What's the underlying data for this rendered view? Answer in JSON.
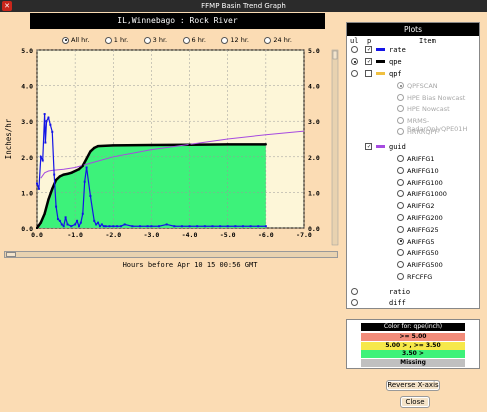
{
  "window": {
    "title": "FFMP Basin Trend Graph"
  },
  "location": "IL,Winnebago : Rock River",
  "time_options": [
    {
      "label": "All hr.",
      "selected": true
    },
    {
      "label": "1 hr.",
      "selected": false
    },
    {
      "label": "3 hr.",
      "selected": false
    },
    {
      "label": "6 hr.",
      "selected": false
    },
    {
      "label": "12 hr.",
      "selected": false
    },
    {
      "label": "24 hr.",
      "selected": false
    }
  ],
  "graph": {
    "ylabel": "Inches/hr",
    "xtitle": "Hours before Apr 10 15 00:56 GMT"
  },
  "chart_data": {
    "type": "line",
    "xlabel": "Hours before Apr 10 15 00:56 GMT",
    "ylabel": "Inches/hr",
    "xlim": [
      0.0,
      -7.0
    ],
    "ylim": [
      0.0,
      5.0
    ],
    "x_ticks": [
      "0.0",
      "-1.0",
      "-2.0",
      "-3.0",
      "-4.0",
      "-5.0",
      "-6.0",
      "-7.0"
    ],
    "y_ticks_left": [
      "0.0",
      "1.0",
      "2.0",
      "3.0",
      "4.0",
      "5.0"
    ],
    "y_ticks_right": [
      "0.0",
      "1.0",
      "2.0",
      "3.0",
      "4.0",
      "5.0"
    ],
    "series": [
      {
        "name": "rate",
        "color": "#1414e6",
        "x": [
          0.0,
          -0.05,
          -0.1,
          -0.15,
          -0.2,
          -0.22,
          -0.25,
          -0.3,
          -0.35,
          -0.4,
          -0.45,
          -0.5,
          -0.55,
          -0.6,
          -0.65,
          -0.7,
          -0.75,
          -0.8,
          -0.9,
          -1.0,
          -1.05,
          -1.1,
          -1.15,
          -1.2,
          -1.25,
          -1.3,
          -1.4,
          -1.5,
          -1.55,
          -1.6,
          -1.65,
          -1.7,
          -1.75,
          -1.8,
          -1.9,
          -2.0,
          -2.1,
          -2.2,
          -2.3,
          -2.5,
          -2.7,
          -2.9,
          -3.0,
          -3.2,
          -3.4,
          -3.6,
          -3.8,
          -4.0,
          -4.2,
          -4.4,
          -4.6,
          -4.8,
          -5.0,
          -5.2,
          -5.4,
          -5.6,
          -5.8,
          -6.0
        ],
        "y": [
          1.25,
          1.1,
          2.0,
          1.9,
          3.2,
          2.4,
          3.0,
          3.1,
          2.9,
          2.7,
          1.5,
          0.6,
          0.25,
          0.2,
          0.1,
          0.05,
          0.3,
          0.1,
          0.05,
          0.1,
          0.2,
          0.05,
          0.15,
          0.4,
          1.3,
          1.7,
          0.9,
          0.2,
          0.1,
          0.15,
          0.05,
          0.1,
          0.05,
          0.05,
          0.05,
          0.05,
          0.05,
          0.05,
          0.1,
          0.05,
          0.05,
          0.05,
          0.05,
          0.05,
          0.1,
          0.05,
          0.05,
          0.05,
          0.05,
          0.05,
          0.05,
          0.05,
          0.05,
          0.05,
          0.05,
          0.05,
          0.05,
          0.05
        ]
      },
      {
        "name": "qpe",
        "color": "#000000",
        "x": [
          0.0,
          -0.1,
          -0.2,
          -0.3,
          -0.4,
          -0.5,
          -0.6,
          -0.7,
          -0.8,
          -0.9,
          -1.0,
          -1.1,
          -1.2,
          -1.3,
          -1.4,
          -1.5,
          -1.6,
          -2.0,
          -3.0,
          -4.0,
          -5.0,
          -6.0
        ],
        "y": [
          0.0,
          0.15,
          0.4,
          0.8,
          1.1,
          1.35,
          1.45,
          1.5,
          1.52,
          1.55,
          1.6,
          1.65,
          1.75,
          1.95,
          2.15,
          2.25,
          2.3,
          2.32,
          2.33,
          2.34,
          2.35,
          2.35
        ]
      },
      {
        "name": "guid",
        "color": "#a64be0",
        "x": [
          -0.1,
          -0.2,
          -0.3,
          -0.4,
          -0.5,
          -0.7,
          -1.0,
          -1.5,
          -2.0,
          -3.0,
          -4.0,
          -5.0,
          -6.0,
          -7.0
        ],
        "y": [
          1.4,
          1.55,
          1.6,
          1.62,
          1.63,
          1.65,
          1.7,
          1.85,
          2.0,
          2.2,
          2.35,
          2.5,
          2.62,
          2.72
        ]
      }
    ],
    "fill_thresholds": {
      "green": "qpe < 3.50",
      "fill_color": "#3df27a"
    },
    "grid": true
  },
  "plots_panel": {
    "title": "Plots",
    "header": {
      "ul": "ul",
      "p": "p",
      "item": "Item"
    },
    "items": [
      {
        "label": "rate",
        "ul": false,
        "p": true,
        "color": "#1414e6"
      },
      {
        "label": "qpe",
        "ul": true,
        "p": true,
        "color": "#000000"
      },
      {
        "label": "qpf",
        "ul": false,
        "p": false,
        "color": "#f0c040"
      }
    ],
    "qpf_sources": [
      "QPFSCAN",
      "HPE Bias Nowcast",
      "HPE Nowcast",
      "MRMS-RadarOnlyQPE01H",
      "HRRRQPF"
    ],
    "qpf_selected": "QPFSCAN",
    "guid": {
      "label": "guid",
      "p": true,
      "color": "#a64be0"
    },
    "guid_sources": [
      "ARIFFG1",
      "ARIFFG10",
      "ARIFFG100",
      "ARIFFG1000",
      "ARIFFG2",
      "ARIFFG200",
      "ARIFFG25",
      "ARIFFG5",
      "ARIFFG50",
      "ARIFFG500",
      "RFCFFG"
    ],
    "guid_selected": "ARIFFG5",
    "ratio": "ratio",
    "diff": "diff"
  },
  "legend": {
    "title": "Color for: qpe(inch)",
    "rows": [
      {
        "label": ">= 5.00",
        "color": "#f28c7a"
      },
      {
        "label": "5.00 > , >= 3.50",
        "color": "#f6e84a"
      },
      {
        "label": "3.50 >",
        "color": "#3df27a"
      },
      {
        "label": "Missing",
        "color": "#c0c0c0"
      }
    ]
  },
  "buttons": {
    "reverse": "Reverse X-axis",
    "close": "Close"
  }
}
